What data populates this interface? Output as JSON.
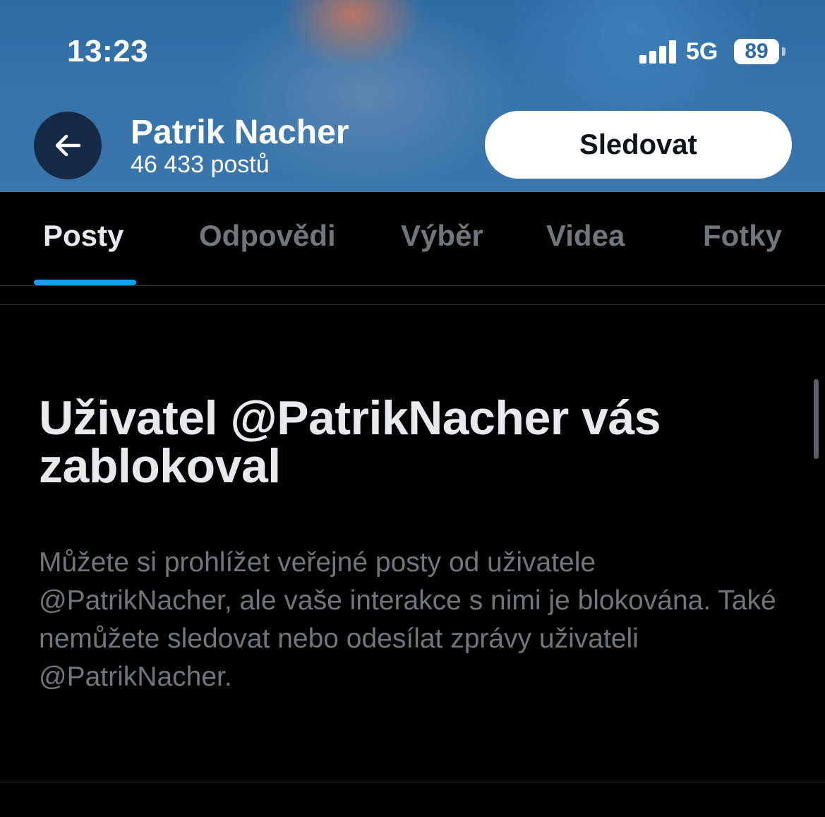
{
  "status_bar": {
    "time": "13:23",
    "network": "5G",
    "battery": "89"
  },
  "header": {
    "profile_name": "Patrik Nacher",
    "post_count": "46 433 postů",
    "follow_label": "Sledovat",
    "back_icon": "arrow-left-icon"
  },
  "tabs": [
    {
      "label": "Posty",
      "active": true
    },
    {
      "label": "Odpovědi",
      "active": false
    },
    {
      "label": "Výběr",
      "active": false
    },
    {
      "label": "Videa",
      "active": false
    },
    {
      "label": "Fotky",
      "active": false
    }
  ],
  "blocked_notice": {
    "title": "Uživatel @PatrikNacher vás zablokoval",
    "description": "Můžete si prohlížet veřejné posty od uživatele @PatrikNacher, ale vaše interakce s nimi je blokována. Také nemůžete sledovat nebo odesílat zprávy uživateli @PatrikNacher."
  },
  "colors": {
    "accent": "#1d9bf0",
    "background": "#000000",
    "text_primary": "#e7e9ea",
    "text_secondary": "#71767b"
  }
}
